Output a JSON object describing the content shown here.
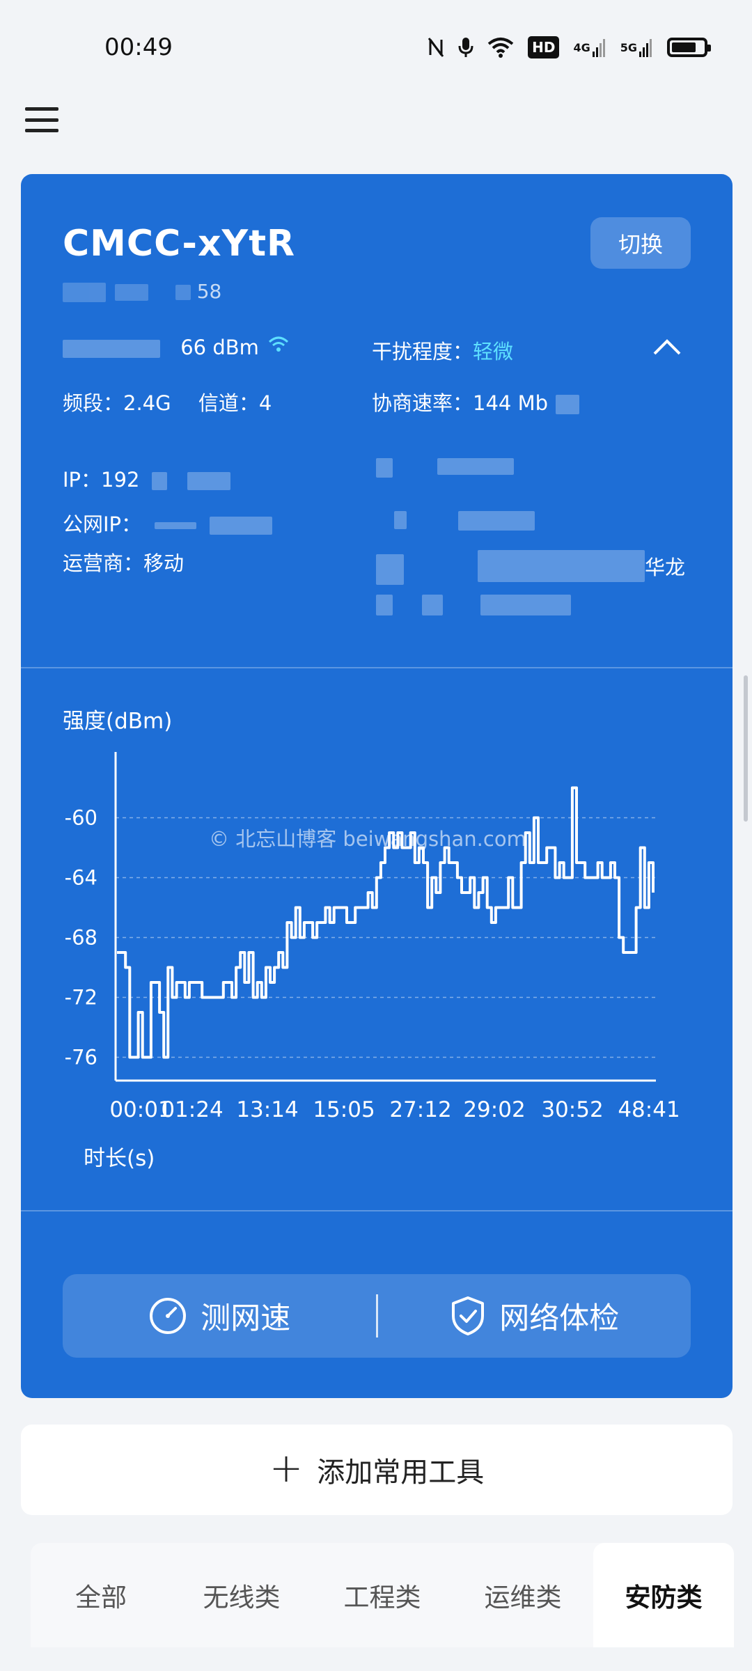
{
  "status_bar": {
    "time": "00:49",
    "icons": [
      "nfc-icon",
      "mic-icon",
      "wifi-icon",
      "hd-icon",
      "4g-signal-icon",
      "5g-signal-icon",
      "battery-icon"
    ],
    "hd_label": "HD",
    "sig1_label": "4G",
    "sig2_label": "5G"
  },
  "network": {
    "ssid": "CMCC-xYtR",
    "mac_visible": "58",
    "switch_label": "切换",
    "signal_strength": "66 dBm",
    "interference_label": "干扰程度：",
    "interference_value": "轻微",
    "band_label": "频段：2.4G",
    "channel_label": "信道：4",
    "rate_label": "协商速率：144 Mb",
    "ip_label": "IP：192",
    "public_ip_label": "公网IP：",
    "carrier_label": "运营商：移动",
    "location_fragment": "华龙"
  },
  "chart_data": {
    "type": "line",
    "title": "强度(dBm)",
    "xlabel": "时长(s)",
    "ylabel": "强度(dBm)",
    "ylim": [
      -77,
      -57
    ],
    "yticks": [
      -60,
      -64,
      -68,
      -72,
      -76
    ],
    "x_tick_labels": [
      "00:01",
      "01:24",
      "13:14",
      "15:05",
      "27:12",
      "29:02",
      "30:52",
      "48:41"
    ],
    "grid": true,
    "series": [
      {
        "values": [
          -69,
          -69,
          -70,
          -76,
          -76,
          -73,
          -76,
          -76,
          -71,
          -71,
          -73,
          -76,
          -70,
          -72,
          -71,
          -71,
          -72,
          -71,
          -71,
          -71,
          -72,
          -72,
          -72,
          -72,
          -72,
          -71,
          -71,
          -72,
          -70,
          -69,
          -71,
          -69,
          -72,
          -71,
          -72,
          -70,
          -71,
          -70,
          -69,
          -70,
          -67,
          -68,
          -66,
          -68,
          -67,
          -67,
          -68,
          -67,
          -67,
          -66,
          -67,
          -66,
          -66,
          -66,
          -67,
          -67,
          -66,
          -66,
          -66,
          -65,
          -66,
          -64,
          -63,
          -62,
          -61,
          -62,
          -61,
          -62,
          -62,
          -61,
          -63,
          -62,
          -63,
          -66,
          -64,
          -65,
          -63,
          -62,
          -63,
          -63,
          -64,
          -65,
          -65,
          -64,
          -66,
          -65,
          -64,
          -66,
          -67,
          -66,
          -66,
          -66,
          -64,
          -66,
          -66,
          -63,
          -61,
          -63,
          -60,
          -63,
          -63,
          -62,
          -62,
          -64,
          -63,
          -64,
          -64,
          -58,
          -63,
          -63,
          -64,
          -64,
          -64,
          -63,
          -64,
          -64,
          -63,
          -64,
          -68,
          -69,
          -69,
          -69,
          -66,
          -62,
          -66,
          -63,
          -65
        ]
      }
    ],
    "watermark": "© 北忘山博客 beiwangshan.com"
  },
  "actions": {
    "speed_test": "测网速",
    "network_check": "网络体检"
  },
  "tools": {
    "add_label": "添加常用工具"
  },
  "categories": [
    "全部",
    "无线类",
    "工程类",
    "运维类",
    "安防类"
  ],
  "active_category": "安防类",
  "colors": {
    "card_bg": "#1e6ed6",
    "accent": "#5ee0ff",
    "page_bg": "#f2f4f7"
  }
}
